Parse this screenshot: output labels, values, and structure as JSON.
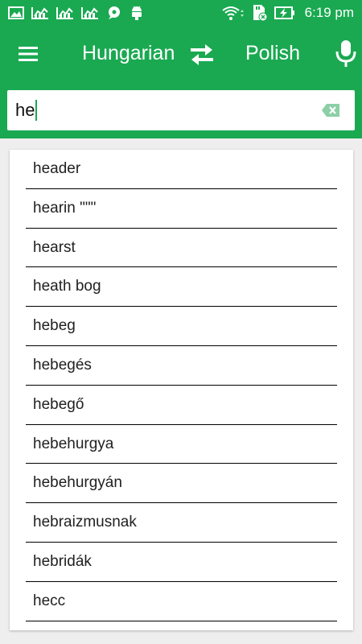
{
  "status_bar": {
    "time": "6:19 pm",
    "left_icons": [
      "image-icon",
      "chart-icon",
      "chart-icon",
      "chart-icon",
      "chat-icon",
      "android-icon"
    ],
    "right_icons": [
      "wifi-icon",
      "sd-card-icon",
      "battery-charging-icon"
    ]
  },
  "app_bar": {
    "source_language": "Hungarian",
    "target_language": "Polish",
    "icons": [
      "menu-icon",
      "swap-icon",
      "mic-icon"
    ]
  },
  "search": {
    "value": "he",
    "clear_icon": "backspace-icon"
  },
  "suggestions": [
    "header",
    "hearin \"\"\"",
    "hearst",
    "heath bog",
    "hebeg",
    "hebegés",
    "hebegő",
    "hebehurgya",
    "hebehurgyán",
    "hebraizmusnak",
    "hebridák",
    "hecc"
  ],
  "colors": {
    "primary": "#1aa951",
    "background": "#eeeeee",
    "text": "#212121"
  }
}
